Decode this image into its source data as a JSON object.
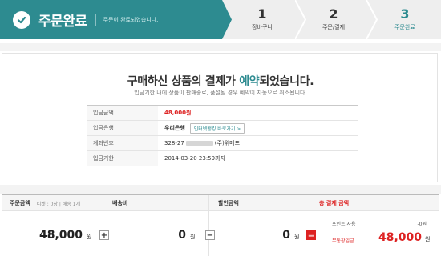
{
  "header": {
    "title": "주문완료",
    "subtitle": "주문이 완료되었습니다.",
    "accent": "#2d8b90",
    "steps": [
      {
        "num": "1",
        "label": "장바구니"
      },
      {
        "num": "2",
        "label": "주문/결제"
      },
      {
        "num": "3",
        "label": "주문완료"
      }
    ]
  },
  "message": {
    "pre": "구매하신 상품의 결제가 ",
    "highlight": "예약",
    "post": "되었습니다.",
    "sub": "입금기한 내에 상품이 판매종료, 품절될 경우 예약이 자동으로 취소됩니다."
  },
  "payment_info": {
    "amount_label": "입금금액",
    "amount": "48,000원",
    "bank_label": "입금은행",
    "bank": "우리은행",
    "bank_button": "인터넷뱅킹 바로가기 >",
    "account_label": "계좌번호",
    "account_prefix": "328-27",
    "account_suffix": "(주)위메프",
    "deadline_label": "입금기한",
    "deadline": "2014-03-20 23:59까지"
  },
  "summary": {
    "order_label": "주문금액",
    "ticket_count": "티켓 : 0장 | 배송 1개",
    "order_value": "48,000",
    "shipping_label": "배송비",
    "shipping_value": "0",
    "discount_label": "할인금액",
    "discount_value": "0",
    "total_label": "총 결제 금액",
    "point_label": "포인트 사용",
    "point_value": "-0원",
    "method_label": "무통장입금",
    "total_value": "48,000",
    "unit": "원",
    "plus": "+",
    "minus": "−",
    "equals": "="
  }
}
